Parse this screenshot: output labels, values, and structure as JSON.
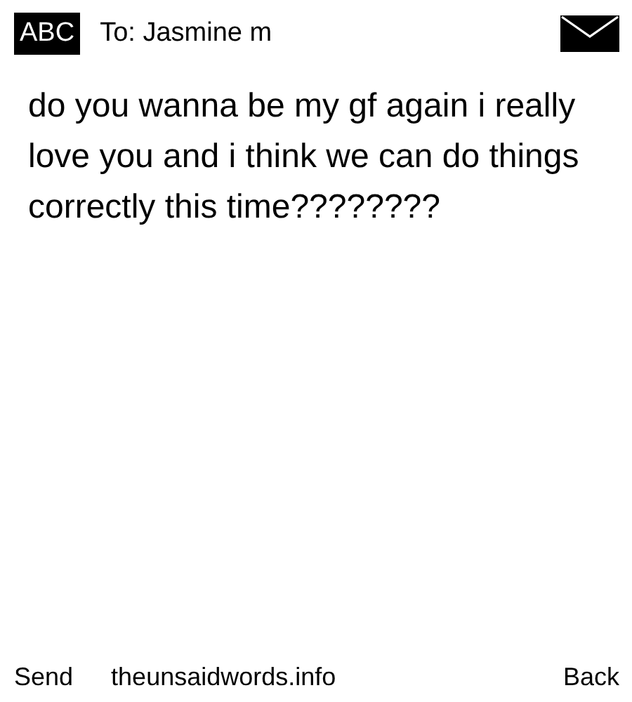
{
  "header": {
    "mode": "ABC",
    "recipient": "To: Jasmine m"
  },
  "message": "do you wanna be my gf again i really love you and i think we can do things correctly this time????????",
  "softkeys": {
    "left": "Send",
    "center": "theunsaidwords.info",
    "right": "Back"
  }
}
